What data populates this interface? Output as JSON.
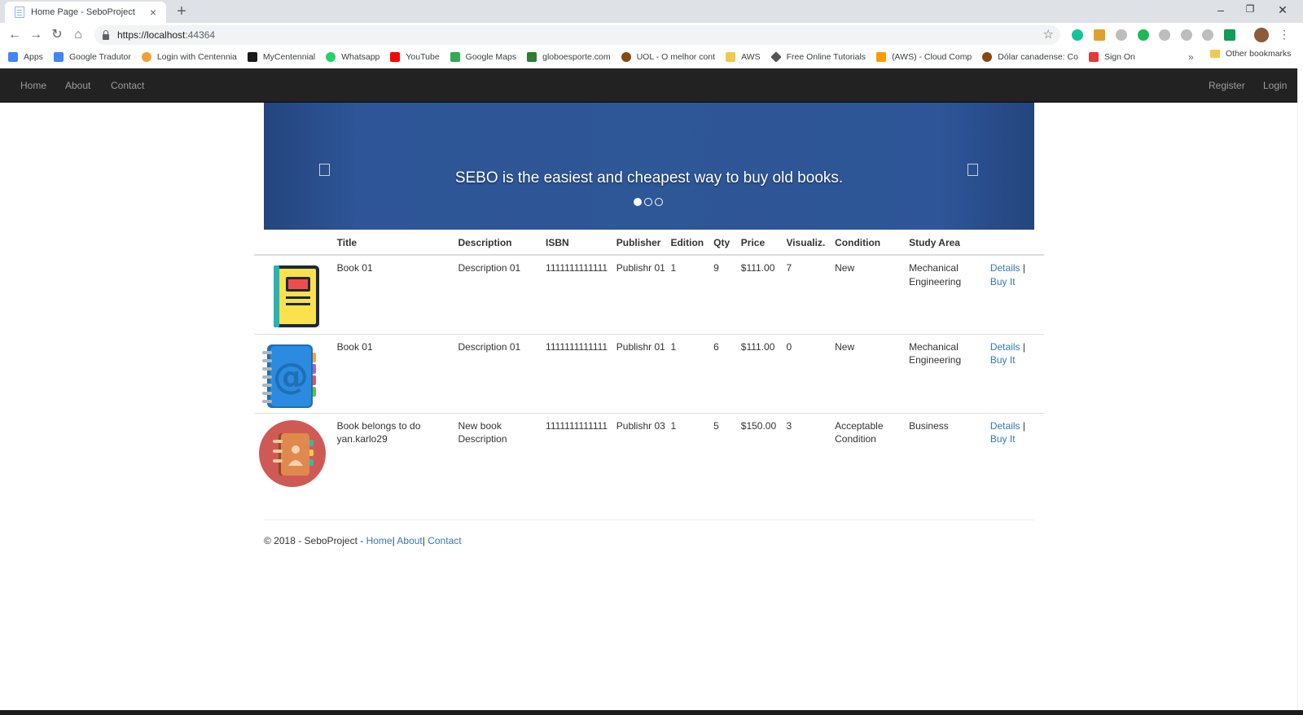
{
  "browser": {
    "tab_title": "Home Page - SeboProject",
    "tab_close": "×",
    "new_tab": "+",
    "url_host": "https://localhost",
    "url_port": ":44364",
    "window_controls": [
      "–",
      "❐",
      "✕"
    ],
    "bookmarks": [
      {
        "label": "Apps",
        "color": "#4285f4"
      },
      {
        "label": "Google Tradutor",
        "color": "#4285f4"
      },
      {
        "label": "Login with Centennia",
        "color": "#f29d38"
      },
      {
        "label": "MyCentennial",
        "color": "#1a1a1a"
      },
      {
        "label": "Whatsapp",
        "color": "#25d366"
      },
      {
        "label": "YouTube",
        "color": "#ff0000"
      },
      {
        "label": "Google Maps",
        "color": "#34a853"
      },
      {
        "label": "globoesporte.com",
        "color": "#2e7d32"
      },
      {
        "label": "UOL - O melhor cont",
        "color": "#8b4513"
      },
      {
        "label": "AWS",
        "color": "#f2c94c"
      },
      {
        "label": "Free Online Tutorials",
        "color": "#555555"
      },
      {
        "label": "(AWS) - Cloud Comp",
        "color": "#ff9900"
      },
      {
        "label": "Dólar canadense: Co",
        "color": "#8b4513"
      },
      {
        "label": "Sign On",
        "color": "#e53935"
      }
    ],
    "bookmarks_more": "»",
    "other_bookmarks": "Other bookmarks"
  },
  "nav": {
    "home": "Home",
    "about": "About",
    "contact": "Contact",
    "register": "Register",
    "login": "Login"
  },
  "carousel": {
    "caption": "SEBO is the easiest and cheapest way to buy old books."
  },
  "table": {
    "headers": [
      "Title",
      "Description",
      "ISBN",
      "Publisher",
      "Edition",
      "Qty",
      "Price",
      "Visualiz.",
      "Condition",
      "Study Area"
    ],
    "details_label": "Details",
    "separator": " |",
    "buy_label": "Buy It",
    "rows": [
      {
        "title": "Book 01",
        "description": "Description 01",
        "isbn": "1111111111111",
        "publisher": "Publishr 01",
        "edition": "1",
        "qty": "9",
        "price": "$111.00",
        "views": "7",
        "condition": "New",
        "study_area": "Mechanical Engineering",
        "icon": "yellow-book-icon"
      },
      {
        "title": "Book 01",
        "description": "Description 01",
        "isbn": "1111111111111",
        "publisher": "Publishr 01",
        "edition": "1",
        "qty": "6",
        "price": "$111.00",
        "views": "0",
        "condition": "New",
        "study_area": "Mechanical Engineering",
        "icon": "address-book-icon"
      },
      {
        "title": "Book belongs to do yan.karlo29",
        "description": "New book Description",
        "isbn": "1111111111111",
        "publisher": "Publishr 03",
        "edition": "1",
        "qty": "5",
        "price": "$150.00",
        "views": "3",
        "condition": "Acceptable Condition",
        "study_area": "Business",
        "icon": "contacts-book-icon"
      }
    ]
  },
  "footer": {
    "text": "© 2018 - SeboProject - ",
    "home": "Home",
    "sep1": "|",
    "about": "About",
    "sep2": "|",
    "contact": "Contact"
  }
}
